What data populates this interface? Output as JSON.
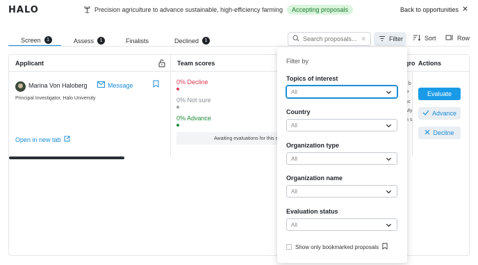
{
  "app": {
    "logo": "HALO"
  },
  "header": {
    "opportunity_title": "Precision agriculture to advance sustainable, high-efficiency farming",
    "status_badge": "Accepting proposals",
    "back_label": "Back to opportunities"
  },
  "tabs": [
    {
      "label": "Screen",
      "count": "1",
      "active": true
    },
    {
      "label": "Assess",
      "count": "1"
    },
    {
      "label": "Finalists"
    },
    {
      "label": "Declined",
      "count": "1"
    }
  ],
  "toolbar": {
    "search_placeholder": "Search proposals...",
    "filter_label": "Filter",
    "sort_label": "Sort",
    "row_label": "Row"
  },
  "table": {
    "headers": {
      "applicant": "Applicant",
      "team_scores": "Team scores",
      "partial": "gro",
      "actions": "Actions"
    },
    "row": {
      "name": "Marina Von Haloberg",
      "message_label": "Message",
      "role": "Principal Investigator, Halo University",
      "open_tab_label": "Open in new tab",
      "scores": {
        "decline": "0% Decline",
        "not_sure": "0% Not sure",
        "advance": "0% Advance"
      },
      "awaiting": "Awaiting evaluations for this st",
      "partial_lines": [
        "t b",
        "P",
        "sc",
        "My",
        "n s"
      ],
      "actions": {
        "evaluate": "Evaluate",
        "advance": "Advance",
        "decline": "Decline"
      }
    }
  },
  "filter_panel": {
    "title": "Filter by",
    "fields": [
      {
        "label": "Topics of interest",
        "value": "All"
      },
      {
        "label": "Country",
        "value": "All"
      },
      {
        "label": "Organization type",
        "value": "All"
      },
      {
        "label": "Organization name",
        "value": "All"
      },
      {
        "label": "Evaluation status",
        "value": "All"
      }
    ],
    "bookmarked_label": "Show only bookmarked proposals"
  },
  "colors": {
    "accent": "#1a9be8",
    "decline": "#d83a52",
    "advance": "#1d8a3a",
    "badge_bg": "#d9f5dc"
  }
}
